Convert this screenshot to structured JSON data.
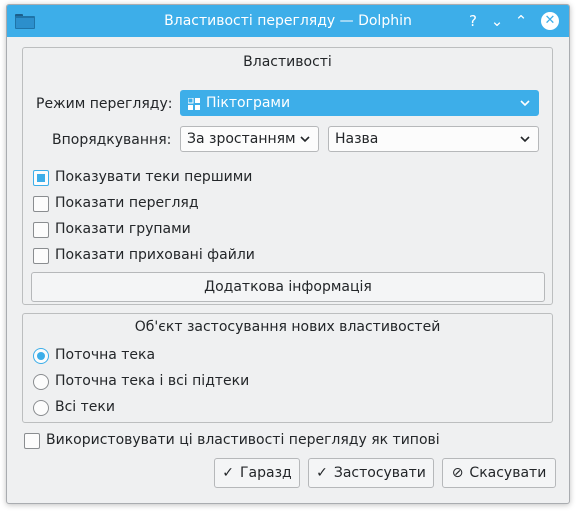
{
  "window": {
    "title": "Властивості перегляду — Dolphin"
  },
  "titlebar": {
    "help_icon": "?",
    "minimize_icon": "⌄",
    "maximize_icon": "⌃",
    "close_icon": "✕"
  },
  "properties": {
    "title": "Властивості",
    "view_mode_label": "Режим перегляду:",
    "view_mode_value": "Піктограми",
    "sorting_label": "Впорядкування:",
    "sort_order_value": "За зростанням",
    "sort_by_value": "Назва",
    "checkboxes": [
      {
        "label": "Показувати теки першими",
        "checked": true
      },
      {
        "label": "Показати перегляд",
        "checked": false
      },
      {
        "label": "Показати групами",
        "checked": false
      },
      {
        "label": "Показати приховані файли",
        "checked": false
      }
    ],
    "additional_info_button": "Додаткова інформація"
  },
  "apply_to": {
    "title": "Об'єкт застосування нових властивостей",
    "options": [
      {
        "label": "Поточна тека",
        "selected": true
      },
      {
        "label": "Поточна тека і всі підтеки",
        "selected": false
      },
      {
        "label": "Всі теки",
        "selected": false
      }
    ]
  },
  "default_checkbox": {
    "label": "Використовувати ці властивості перегляду як типові",
    "checked": false
  },
  "buttons": {
    "ok": "Гаразд",
    "apply": "Застосувати",
    "cancel": "Скасувати"
  },
  "colors": {
    "accent": "#3daee9",
    "window_bg": "#eff0f1",
    "text": "#232629"
  }
}
